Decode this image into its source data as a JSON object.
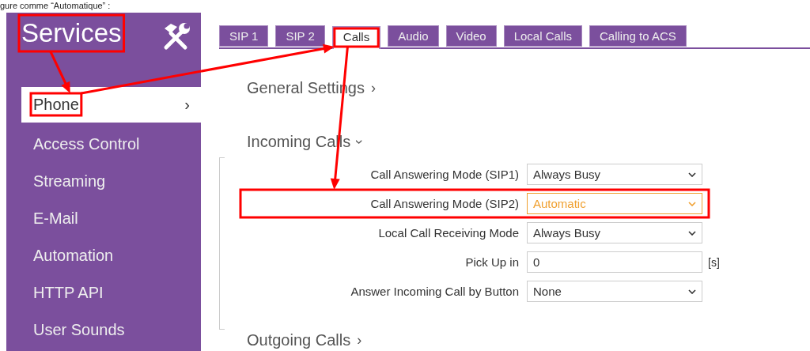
{
  "caption": "gure comme “Automatique” :",
  "sidebar": {
    "title": "Services",
    "title_highlighted": true,
    "items": [
      {
        "label": "Phone",
        "selected": true,
        "highlighted": true,
        "chevron": "›"
      },
      {
        "label": "Access Control",
        "selected": false,
        "highlighted": false
      },
      {
        "label": "Streaming",
        "selected": false,
        "highlighted": false
      },
      {
        "label": "E-Mail",
        "selected": false,
        "highlighted": false
      },
      {
        "label": "Automation",
        "selected": false,
        "highlighted": false
      },
      {
        "label": "HTTP API",
        "selected": false,
        "highlighted": false
      },
      {
        "label": "User Sounds",
        "selected": false,
        "highlighted": false
      }
    ]
  },
  "tabs": [
    {
      "label": "SIP 1",
      "selected": false,
      "highlighted": false
    },
    {
      "label": "SIP 2",
      "selected": false,
      "highlighted": false
    },
    {
      "label": "Calls",
      "selected": true,
      "highlighted": true
    },
    {
      "label": "Audio",
      "selected": false,
      "highlighted": false
    },
    {
      "label": "Video",
      "selected": false,
      "highlighted": false
    },
    {
      "label": "Local Calls",
      "selected": false,
      "highlighted": false
    },
    {
      "label": "Calling to ACS",
      "selected": false,
      "highlighted": false
    }
  ],
  "sections": [
    {
      "title": "General Settings",
      "expanded": false,
      "chevron": "›"
    },
    {
      "title": "Incoming Calls",
      "expanded": true,
      "chevron": "›",
      "fields": [
        {
          "kind": "select",
          "label": "Call Answering Mode (SIP1)",
          "value": "Always Busy",
          "focused": false,
          "highlighted": false
        },
        {
          "kind": "select",
          "label": "Call Answering Mode (SIP2)",
          "value": "Automatic",
          "focused": true,
          "highlighted": true
        },
        {
          "kind": "select",
          "label": "Local Call Receiving Mode",
          "value": "Always Busy",
          "focused": false,
          "highlighted": false
        },
        {
          "kind": "text",
          "label": "Pick Up in",
          "value": "0",
          "unit": "[s]",
          "focused": false,
          "highlighted": false
        },
        {
          "kind": "select",
          "label": "Answer Incoming Call by Button",
          "value": "None",
          "focused": false,
          "highlighted": false
        }
      ]
    },
    {
      "title": "Outgoing Calls",
      "expanded": false,
      "chevron": "›"
    }
  ]
}
